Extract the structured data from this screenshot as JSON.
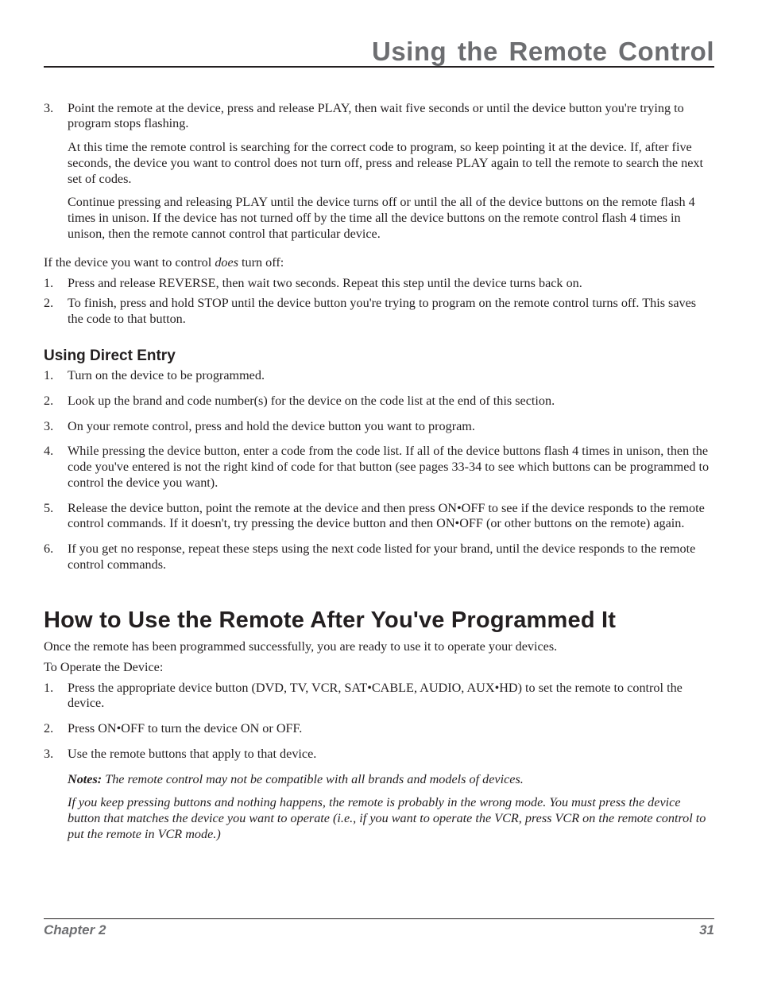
{
  "header": {
    "title": "Using the Remote Control"
  },
  "section1": {
    "step3": {
      "num": "3.",
      "p1": "Point the remote at the device, press and release PLAY, then wait five seconds or until the device button you're trying to program stops flashing.",
      "p2": "At this time the remote control is searching for the correct code to program, so keep pointing it at the device. If, after five seconds, the device you want to control does not turn off, press and release PLAY again to tell the remote to search the next set of codes.",
      "p3": "Continue pressing and releasing PLAY until the device turns off or until the all of the device buttons on the remote flash 4 times in unison. If the device has not turned off by the time all the device buttons on the remote control flash 4 times in unison, then the remote cannot control that particular device."
    },
    "if_off_pre": "If the device you want to control ",
    "if_off_em": "does",
    "if_off_post": " turn off:",
    "substeps": [
      {
        "num": "1.",
        "text": "Press and release REVERSE, then wait two seconds. Repeat this step until the device turns back on."
      },
      {
        "num": "2.",
        "text": "To finish, press and hold STOP until the device button you're trying to program on the remote control turns off. This saves the code to that button."
      }
    ]
  },
  "direct_entry": {
    "heading": "Using Direct Entry",
    "steps": [
      {
        "num": "1.",
        "text": "Turn on the device to be programmed."
      },
      {
        "num": "2.",
        "text": "Look up the brand and code number(s) for the device on the code list at the end of this section."
      },
      {
        "num": "3.",
        "text": "On your remote control, press and hold the device button you want to program."
      },
      {
        "num": "4.",
        "text": "While pressing the device button, enter a code from the code list. If all of the device buttons flash 4 times in unison, then the code you've entered is not the right kind of code for that button (see pages 33-34 to see which buttons can be programmed to control the device you want)."
      },
      {
        "num": "5.",
        "text": "Release the device button, point the remote at the device and then press ON•OFF to see if the device responds to the remote control commands. If it doesn't, try pressing the device button and then ON•OFF (or other buttons on the remote) again."
      },
      {
        "num": "6.",
        "text": "If you get no response, repeat these steps using the next code listed for your brand, until the device responds to the remote control commands."
      }
    ]
  },
  "how_to_use": {
    "heading": "How to Use the Remote After You've Programmed It",
    "intro": "Once the remote has been programmed successfully, you are ready to use it to operate your devices.",
    "operate_label": "To Operate the Device:",
    "steps": [
      {
        "num": "1.",
        "text": "Press the appropriate device button (DVD, TV, VCR, SAT•CABLE, AUDIO, AUX•HD) to set the remote to control the device."
      },
      {
        "num": "2.",
        "text": "Press ON•OFF to turn the device ON or OFF."
      },
      {
        "num": "3.",
        "text": "Use the remote buttons that apply to that device."
      }
    ],
    "notes_lead": "Notes:",
    "notes_p1": " The remote control may not be compatible with all brands and models of devices.",
    "notes_p2": "If you keep pressing buttons and nothing happens, the remote is probably in the wrong mode. You must press the device button that matches the device you want to operate (i.e., if you want to operate the VCR, press VCR on the remote control to put the remote in VCR mode.)"
  },
  "footer": {
    "chapter": "Chapter 2",
    "page": "31"
  }
}
